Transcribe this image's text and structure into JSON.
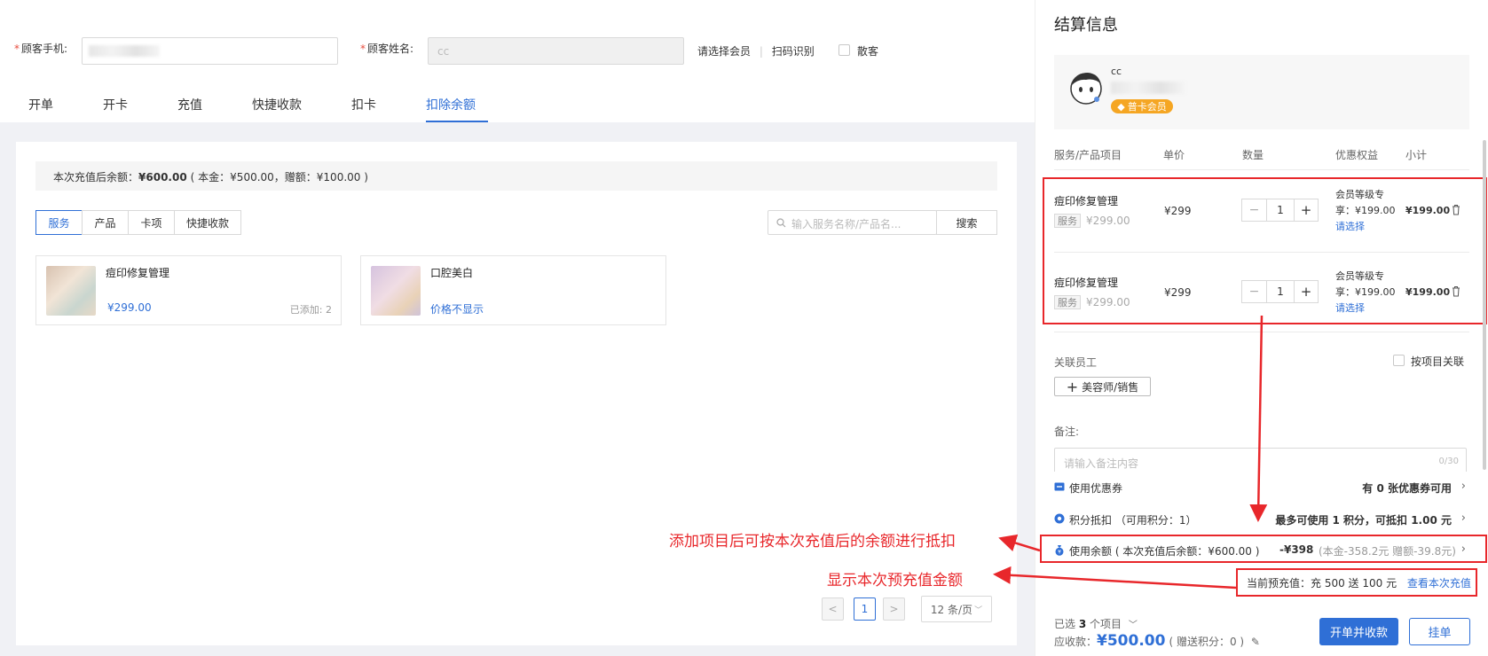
{
  "form": {
    "phone_label": "顾客手机:",
    "name_label": "顾客姓名:",
    "name_value": "cc",
    "select_member": "请选择会员",
    "scan": "扫码识别",
    "walk_in": "散客"
  },
  "tabs": [
    "开单",
    "开卡",
    "充值",
    "快捷收款",
    "扣卡",
    "扣除余额"
  ],
  "balance_bar": {
    "prefix": "本次充值后余额：",
    "amount": "¥600.00",
    "detail": "( 本金：¥500.00，赠额：¥100.00 )"
  },
  "segments": [
    "服务",
    "产品",
    "卡项",
    "快捷收款"
  ],
  "search": {
    "placeholder": "输入服务名称/产品名...",
    "button": "搜索"
  },
  "products": [
    {
      "name": "痘印修复管理",
      "price": "¥299.00",
      "added": "已添加: 2"
    },
    {
      "name": "口腔美白",
      "price": "价格不显示",
      "added": ""
    }
  ],
  "pager": {
    "prev": "<",
    "current": "1",
    "next": ">",
    "size": "12 条/页"
  },
  "checkout": {
    "title": "结算信息",
    "member_name": "cc",
    "member_badge": "普卡会员",
    "headers": [
      "服务/产品项目",
      "单价",
      "数量",
      "优惠权益",
      "小计"
    ],
    "items": [
      {
        "name": "痘印修复管理",
        "tag": "服务",
        "orig_price": "¥299.00",
        "unit_price": "¥299",
        "qty": "1",
        "benefit_1": "会员等级专",
        "benefit_2": "享：¥199.00",
        "choose": "请选择",
        "subtotal": "¥199.00"
      },
      {
        "name": "痘印修复管理",
        "tag": "服务",
        "orig_price": "¥299.00",
        "unit_price": "¥299",
        "qty": "1",
        "benefit_1": "会员等级专",
        "benefit_2": "享：¥199.00",
        "choose": "请选择",
        "subtotal": "¥199.00"
      }
    ],
    "staff_label": "关联员工",
    "by_item": "按项目关联",
    "add_staff": "美容师/销售",
    "remark_label": "备注:",
    "remark_placeholder": "请输入备注内容",
    "remark_count": "0/30",
    "coupon_label": "使用优惠券",
    "coupon_value_pre": "有 ",
    "coupon_value_num": "0",
    "coupon_value_post": " 张优惠券可用",
    "points_label": "积分抵扣 （可用积分：1）",
    "points_value": "最多可使用 1 积分，可抵扣 1.00 元",
    "balance_label": "使用余额 ( 本次充值后余额：¥600.00 )",
    "balance_value": "-¥398",
    "balance_detail": "(本金-358.2元 赠额-39.8元)",
    "prepaid_label": "当前预充值：充 500 送 100 元",
    "prepaid_link": "查看本次充值",
    "selected_pre": "已选 ",
    "selected_num": "3",
    "selected_post": " 个项目",
    "receivable_label": "应收款：",
    "receivable_amount": "¥500.00",
    "receivable_note": "( 赠送积分：0 )",
    "pay_button": "开单并收款",
    "hang_button": "挂单"
  },
  "annotations": {
    "a1": "添加项目后可按本次充值后的余额进行抵扣",
    "a2": "显示本次预充值金额"
  },
  "colors": {
    "accent": "#2f6fd6",
    "annotation": "#e8272b",
    "badge": "#f5a623"
  }
}
